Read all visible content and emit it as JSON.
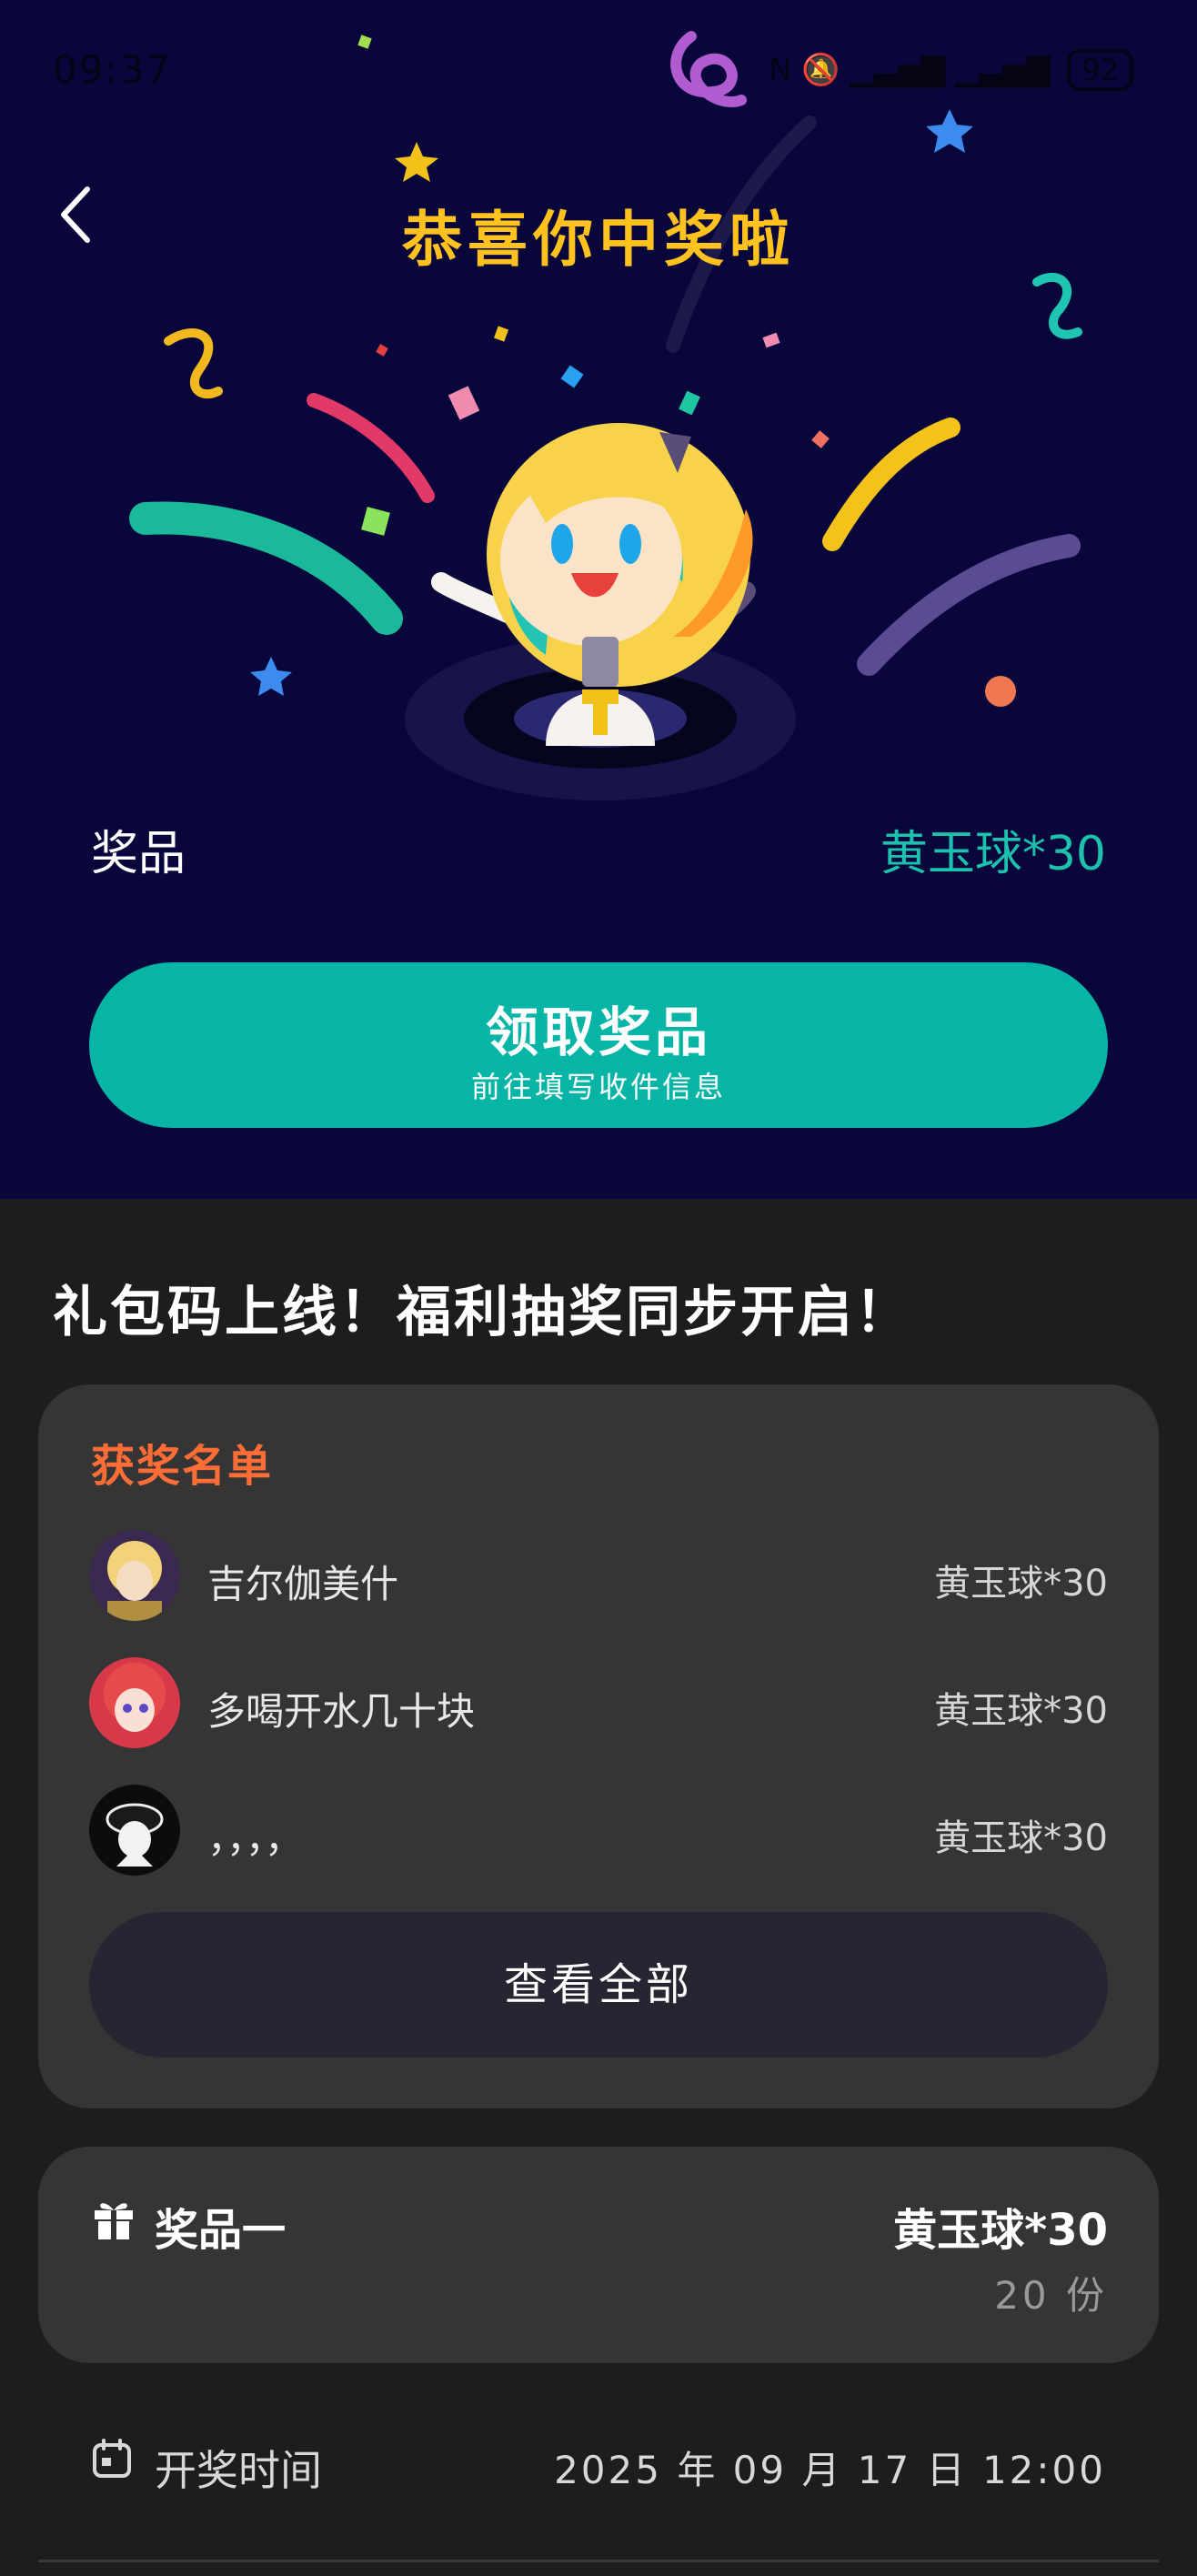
{
  "status_bar": {
    "time": "09:37",
    "battery": "92"
  },
  "hero": {
    "title": "恭喜你中奖啦",
    "prize_label": "奖品",
    "prize_value": "黄玉球*30",
    "claim_button": {
      "title": "领取奖品",
      "subtitle": "前往填写收件信息"
    }
  },
  "headline": "礼包码上线！福利抽奖同步开启！",
  "winners": {
    "title": "获奖名单",
    "rows": [
      {
        "name": "吉尔伽美什",
        "prize": "黄玉球*30"
      },
      {
        "name": "多喝开水几十块",
        "prize": "黄玉球*30"
      },
      {
        "name": "，，，，",
        "prize": "黄玉球*30"
      }
    ],
    "view_all_label": "查看全部"
  },
  "prize_item": {
    "label": "奖品一",
    "value": "黄玉球*30",
    "count": "20 份"
  },
  "draw_time": {
    "label": "开奖时间",
    "value": "2025 年 09 月 17 日 12:00"
  },
  "colors": {
    "hero_background": "#08063a",
    "accent_teal": "#06b5a6",
    "title_yellow": "#ffc21f",
    "winners_title_orange": "#ff6d36"
  }
}
